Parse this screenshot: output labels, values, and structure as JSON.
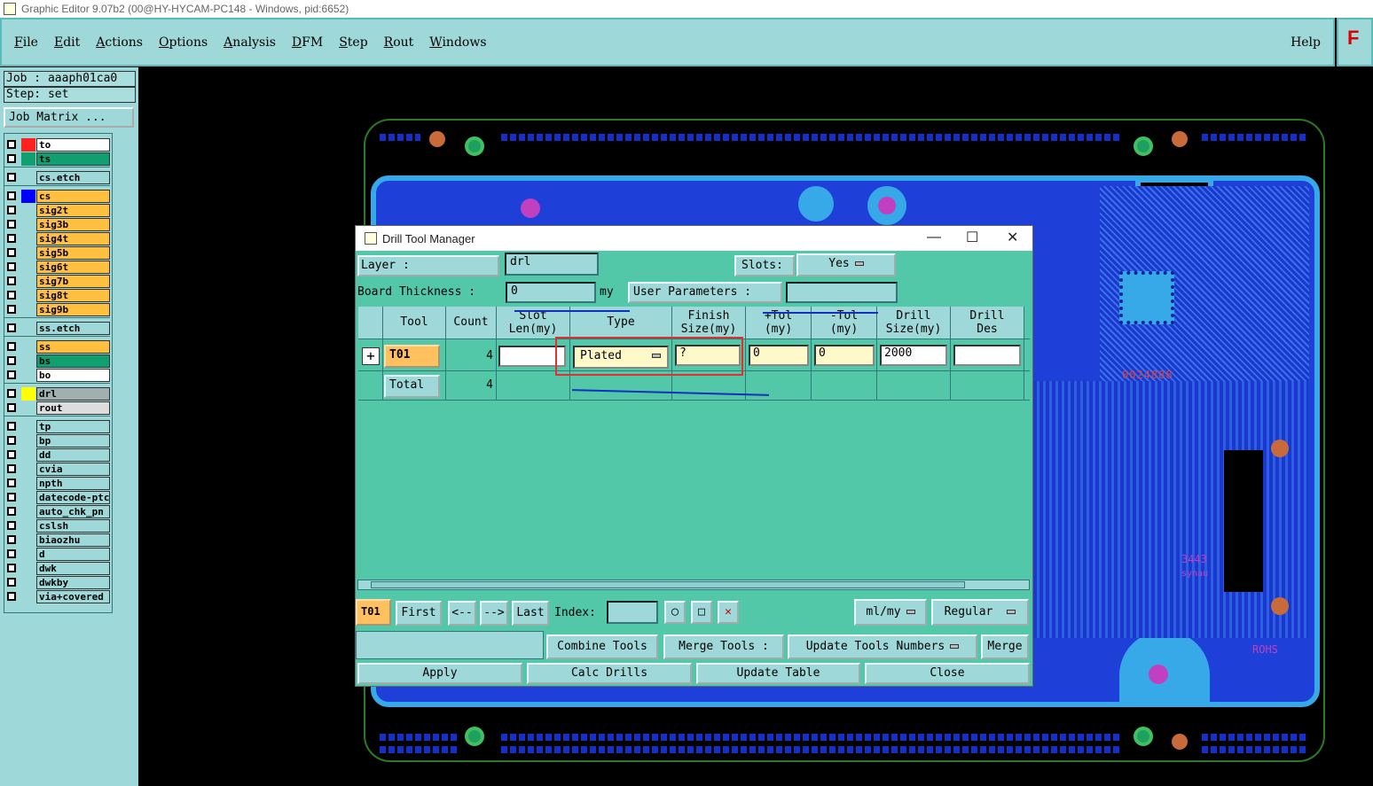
{
  "window": {
    "title": "Graphic Editor 9.07b2 (00@HY-HYCAM-PC148 - Windows, pid:6652)"
  },
  "menu": {
    "items": [
      "File",
      "Edit",
      "Actions",
      "Options",
      "Analysis",
      "DFM",
      "Step",
      "Rout",
      "Windows"
    ],
    "help": "Help"
  },
  "logo_text": "F",
  "job": {
    "job": "Job : aaaph01ca0",
    "step": "Step: set",
    "matrix_button": "Job Matrix ..."
  },
  "layers": [
    {
      "name": "to",
      "color": "#ffffff",
      "swatch": "#ff2020"
    },
    {
      "name": "ts",
      "color": "#10a070",
      "swatch": "#10a070"
    },
    {
      "name": "cs.etch",
      "color": "#9fd8d8",
      "swatch": ""
    },
    {
      "name": "cs",
      "color": "#ffc040",
      "swatch": "#0000ff"
    },
    {
      "name": "sig2t",
      "color": "#ffc040",
      "swatch": ""
    },
    {
      "name": "sig3b",
      "color": "#ffc040",
      "swatch": ""
    },
    {
      "name": "sig4t",
      "color": "#ffc040",
      "swatch": ""
    },
    {
      "name": "sig5b",
      "color": "#ffc040",
      "swatch": ""
    },
    {
      "name": "sig6t",
      "color": "#ffc040",
      "swatch": ""
    },
    {
      "name": "sig7b",
      "color": "#ffc040",
      "swatch": ""
    },
    {
      "name": "sig8t",
      "color": "#ffc040",
      "swatch": ""
    },
    {
      "name": "sig9b",
      "color": "#ffc040",
      "swatch": ""
    },
    {
      "name": "ss.etch",
      "color": "#9fd8d8",
      "swatch": ""
    },
    {
      "name": "ss",
      "color": "#ffc040",
      "swatch": ""
    },
    {
      "name": "bs",
      "color": "#10a070",
      "swatch": ""
    },
    {
      "name": "bo",
      "color": "#ffffff",
      "swatch": ""
    },
    {
      "name": "drl",
      "color": "#a0b0b0",
      "swatch": "#ffff00"
    },
    {
      "name": "rout",
      "color": "#dddddd",
      "swatch": ""
    },
    {
      "name": "tp",
      "color": "#9fd8d8",
      "swatch": ""
    },
    {
      "name": "bp",
      "color": "#9fd8d8",
      "swatch": ""
    },
    {
      "name": "dd",
      "color": "#9fd8d8",
      "swatch": ""
    },
    {
      "name": "cvia",
      "color": "#9fd8d8",
      "swatch": ""
    },
    {
      "name": "npth",
      "color": "#9fd8d8",
      "swatch": ""
    },
    {
      "name": "datecode-ptc",
      "color": "#9fd8d8",
      "swatch": ""
    },
    {
      "name": "auto_chk_pn",
      "color": "#9fd8d8",
      "swatch": ""
    },
    {
      "name": "cslsh",
      "color": "#9fd8d8",
      "swatch": ""
    },
    {
      "name": "biaozhu",
      "color": "#9fd8d8",
      "swatch": ""
    },
    {
      "name": "d",
      "color": "#9fd8d8",
      "swatch": ""
    },
    {
      "name": "dwk",
      "color": "#9fd8d8",
      "swatch": ""
    },
    {
      "name": "dwkby",
      "color": "#9fd8d8",
      "swatch": ""
    },
    {
      "name": "via+covered",
      "color": "#9fd8d8",
      "swatch": ""
    }
  ],
  "dialog": {
    "title": "Drill Tool Manager",
    "layer_label": "Layer            :",
    "layer_value": "drl",
    "slots_label": "Slots:",
    "slots_value": "Yes",
    "thickness_label": "Board Thickness  :",
    "thickness_value": "0",
    "thickness_unit": "my",
    "user_params": "User Parameters  :",
    "user_params_value": "",
    "columns": [
      "Tool",
      "Count",
      "Slot\nLen(my)",
      "Type",
      "Finish\nSize(my)",
      "+Tol\n(my)",
      "-Tol\n(my)",
      "Drill\nSize(my)",
      "Drill\nDes"
    ],
    "row": {
      "tool": "T01",
      "count": "4",
      "slot_len": "",
      "type": "Plated",
      "finish": "?",
      "ptol": "0",
      "ntol": "0",
      "drill_size": "2000",
      "drill_des": ""
    },
    "total": {
      "label": "Total",
      "count": "4"
    },
    "nav": {
      "current": "T01",
      "first": "First",
      "prev": "<--",
      "next": "-->",
      "last": "Last",
      "index_label": "Index:",
      "index_value": "",
      "units": "ml/my",
      "mode": "Regular"
    },
    "combine": "Combine Tools",
    "merge_label": "Merge Tools  :",
    "merge_option": "Update Tools Numbers",
    "merge": "Merge",
    "apply": "Apply",
    "calc": "Calc Drills",
    "update": "Update Table",
    "close": "Close"
  },
  "board_text": {
    "code": "0024888",
    "num": "3443",
    "sig": "synau",
    "rohs": "ROHS"
  }
}
